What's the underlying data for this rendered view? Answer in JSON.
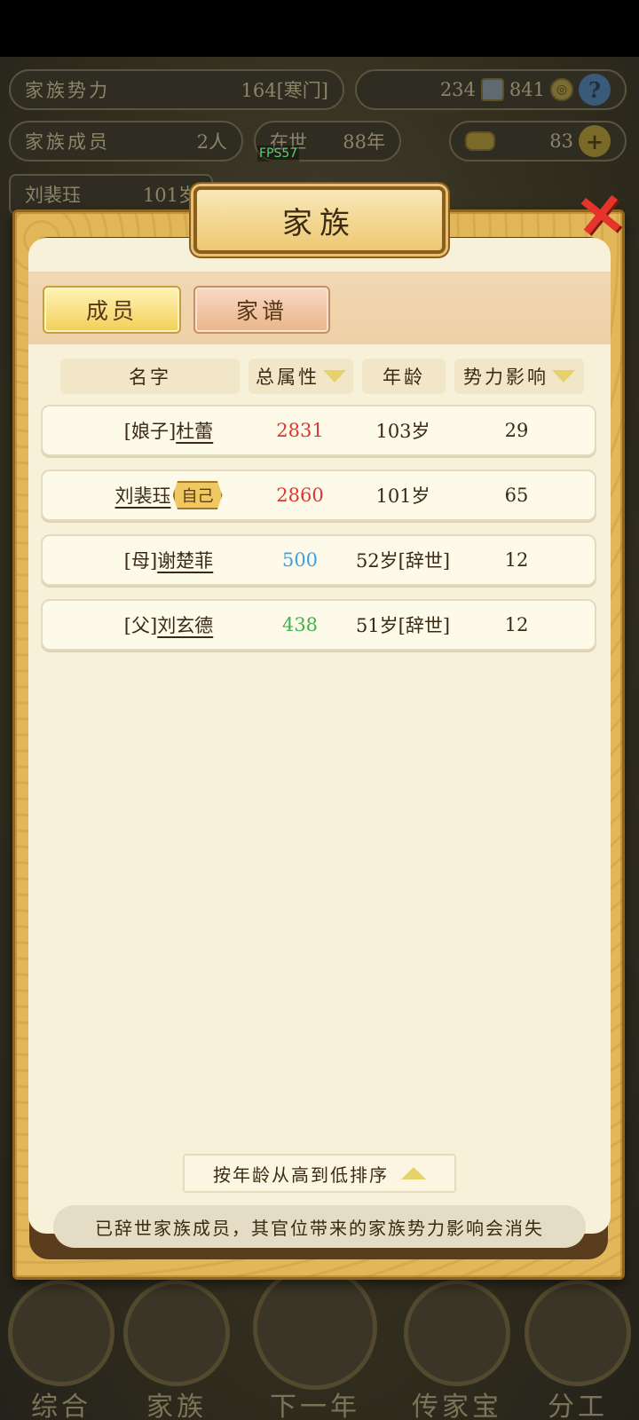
{
  "hud": {
    "family_power_label": "家族势力",
    "family_power_value": "164[寒门]",
    "silver_value": "234",
    "copper_value": "841",
    "help_icon": "question-icon",
    "members_label": "家族成员",
    "members_value": "2人",
    "alive_label": "在世",
    "alive_value": "88年",
    "gold_value": "83",
    "player_name": "刘裴珏",
    "player_age": "101岁",
    "fps": "FPS57"
  },
  "dialog": {
    "title": "家族",
    "close_icon": "close-x-icon",
    "tabs": [
      {
        "label": "成员",
        "active": true
      },
      {
        "label": "家谱",
        "active": false
      }
    ],
    "columns": {
      "name": "名字",
      "attr": "总属性",
      "age": "年龄",
      "influence": "势力影响"
    },
    "rows": [
      {
        "prefix": "[娘子]",
        "name": "杜蕾",
        "badge": "",
        "attr": "2831",
        "attr_color": "#d83a2f",
        "age": "103岁",
        "influence": "29"
      },
      {
        "prefix": "",
        "name": "刘裴珏",
        "badge": "自己",
        "attr": "2860",
        "attr_color": "#d83a2f",
        "age": "101岁",
        "influence": "65"
      },
      {
        "prefix": "[母]",
        "name": "谢楚菲",
        "badge": "",
        "attr": "500",
        "attr_color": "#3da0e5",
        "age": "52岁[辞世]",
        "influence": "12"
      },
      {
        "prefix": "[父]",
        "name": "刘玄德",
        "badge": "",
        "attr": "438",
        "attr_color": "#41b34a",
        "age": "51岁[辞世]",
        "influence": "12"
      }
    ],
    "sort_label": "按年龄从高到低排序",
    "notice": "已辞世家族成员，其官位带来的家族势力影响会消失"
  },
  "bottom_nav": [
    {
      "label": "综合",
      "icon": "scroll-icon"
    },
    {
      "label": "家族",
      "icon": "house-icon"
    },
    {
      "label": "下一年",
      "icon": "mountain-icon"
    },
    {
      "label": "传家宝",
      "icon": "treasure-icon"
    },
    {
      "label": "分工",
      "icon": "person-icon"
    }
  ]
}
